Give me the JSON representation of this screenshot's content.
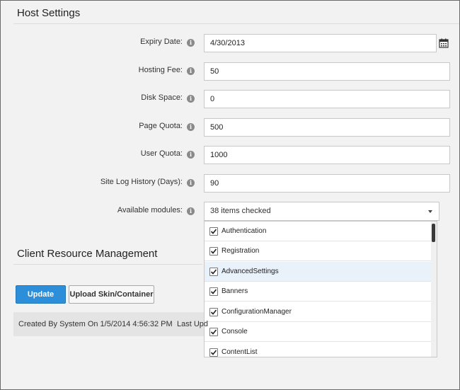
{
  "host_settings": {
    "title": "Host Settings",
    "expiry_date": {
      "label": "Expiry Date:",
      "value": "4/30/2013"
    },
    "hosting_fee": {
      "label": "Hosting Fee:",
      "value": "50"
    },
    "disk_space": {
      "label": "Disk Space:",
      "value": "0"
    },
    "page_quota": {
      "label": "Page Quota:",
      "value": "500"
    },
    "user_quota": {
      "label": "User Quota:",
      "value": "1000"
    },
    "site_log_history": {
      "label": "Site Log History (Days):",
      "value": "90"
    },
    "available_modules": {
      "label": "Available modules:",
      "selected_text": "38 items checked",
      "items": [
        {
          "label": "Authentication",
          "checked": true
        },
        {
          "label": "Registration",
          "checked": true
        },
        {
          "label": "AdvancedSettings",
          "checked": true
        },
        {
          "label": "Banners",
          "checked": true
        },
        {
          "label": "ConfigurationManager",
          "checked": true
        },
        {
          "label": "Console",
          "checked": true
        },
        {
          "label": "ContentList",
          "checked": true
        }
      ]
    }
  },
  "client_resource_management": {
    "title": "Client Resource Management"
  },
  "actions": {
    "update_label": "Update",
    "upload_label": "Upload Skin/Container"
  },
  "footer": {
    "created_by": "Created By System On 1/5/2014 4:56:32 PM",
    "last_updated": "Last Upd"
  },
  "icons": {
    "info": "info-icon",
    "calendar": "calendar-icon",
    "dropdown": "chevron-down-icon",
    "checkbox": "checkmark-icon"
  },
  "colors": {
    "primary_button": "#2d8fd9",
    "highlight_row": "#e9f1fb"
  }
}
